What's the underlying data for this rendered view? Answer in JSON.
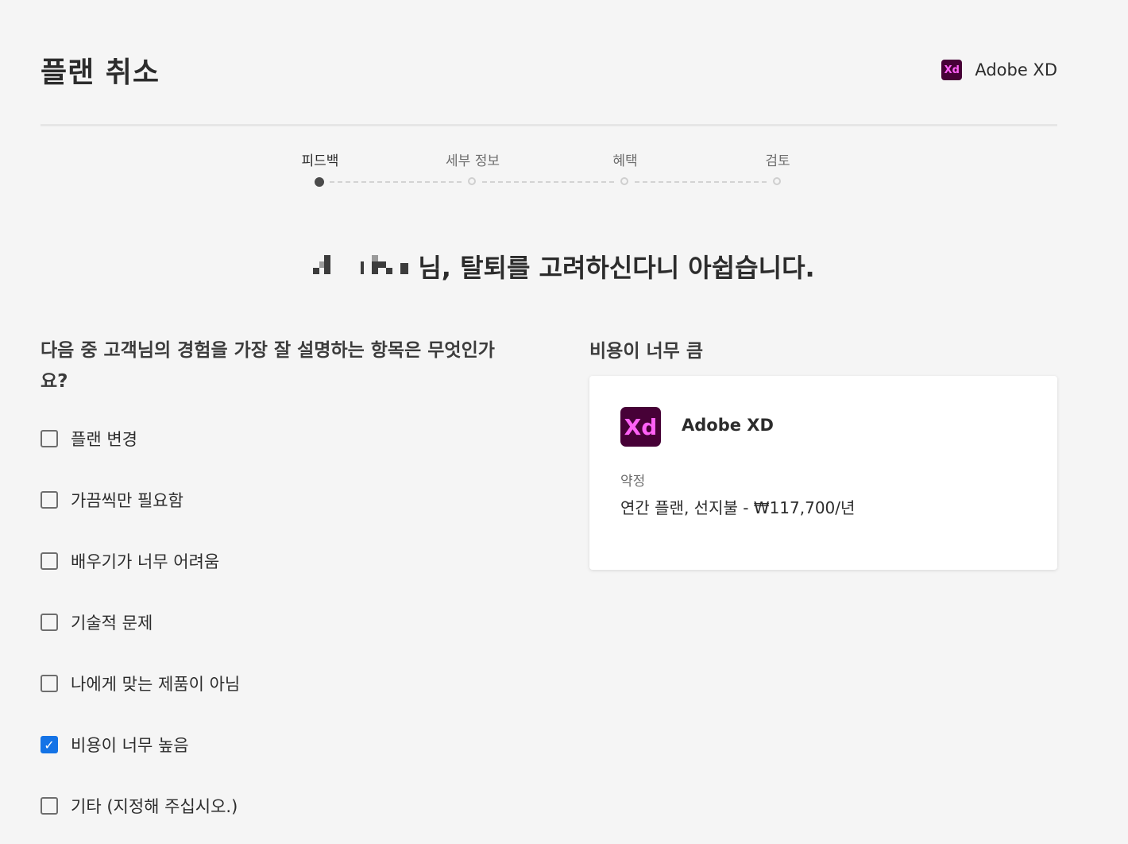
{
  "header": {
    "title": "플랜 취소",
    "product_logo_text": "Xd",
    "product_name": "Adobe XD"
  },
  "stepper": {
    "steps": [
      {
        "label": "피드백",
        "active": true
      },
      {
        "label": "세부 정보",
        "active": false
      },
      {
        "label": "혜택",
        "active": false
      },
      {
        "label": "검토",
        "active": false
      }
    ]
  },
  "greeting": {
    "suffix": "님, 탈퇴를 고려하신다니 아쉽습니다."
  },
  "survey": {
    "question": "다음 중 고객님의 경험을 가장 잘 설명하는 항목은 무엇인가요?",
    "options": [
      {
        "label": "플랜 변경",
        "checked": false
      },
      {
        "label": "가끔씩만 필요함",
        "checked": false
      },
      {
        "label": "배우기가 너무 어려움",
        "checked": false
      },
      {
        "label": "기술적 문제",
        "checked": false
      },
      {
        "label": "나에게 맞는 제품이 아님",
        "checked": false
      },
      {
        "label": "비용이 너무 높음",
        "checked": true
      },
      {
        "label": "기타 (지정해 주십시오.)",
        "checked": false
      }
    ]
  },
  "reason_panel": {
    "title": "비용이 너무 큼",
    "card": {
      "logo_text": "Xd",
      "product_name": "Adobe XD",
      "term_label": "약정",
      "term_value": "연간 플랜, 선지불 - ₩117,700/년"
    }
  },
  "colors": {
    "background": "#f5f5f5",
    "xd_logo_bg": "#470137",
    "xd_logo_fg": "#ff61f6",
    "checkbox_checked": "#1473e6"
  }
}
